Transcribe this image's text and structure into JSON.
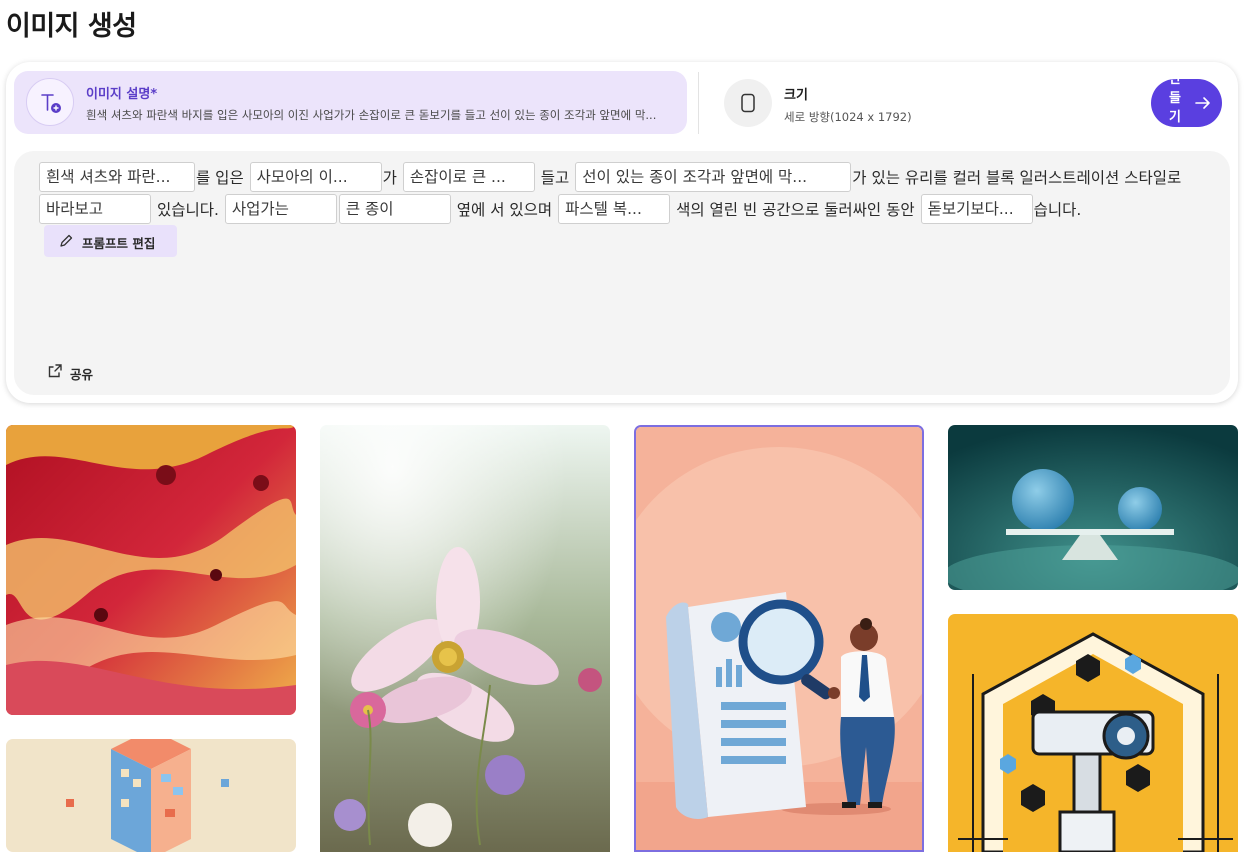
{
  "page": {
    "title": "이미지 생성"
  },
  "description": {
    "title": "이미지 설명*",
    "text": "흰색 셔츠와 파란색 바지를 입은 사모아의 이진 사업가가 손잡이로 큰 돋보기를 들고 선이 있는 종이 조각과 앞면에 막..."
  },
  "size": {
    "title": "크기",
    "value": "세로 방향(1024 x 1792)"
  },
  "create_button": {
    "label": "만들기"
  },
  "prompt": {
    "slots": [
      "흰색 셔츠와 파란...",
      "사모아의 이...",
      "손잡이로 큰 ...",
      "선이 있는 종이 조각과 앞면에 막...",
      "바라보고",
      "사업가는",
      "큰 종이",
      "파스텔 복...",
      "돋보기보다..."
    ],
    "text": [
      "를 입은",
      "가",
      "들고",
      "가 있는 유리를 컬러 블록 일러스트레이션 스타일로",
      "있습니다.",
      "옆에 서 있으며",
      "색의 열린 빈 공간으로 둘러싸인 동안",
      "습니다."
    ]
  },
  "actions": {
    "edit_label": "프롬프트 편집",
    "share_label": "공유"
  },
  "gallery": [
    {
      "name": "abstract-liquid-red-gold"
    },
    {
      "name": "isometric-building"
    },
    {
      "name": "cosmos-flower-field"
    },
    {
      "name": "businessman-magnifying-glass"
    },
    {
      "name": "balance-spheres-teal"
    },
    {
      "name": "security-camera-hexagon"
    }
  ],
  "colors": {
    "accent": "#5a3fe0",
    "accent_soft": "#ece4fb",
    "surface": "#f4f4f4"
  }
}
